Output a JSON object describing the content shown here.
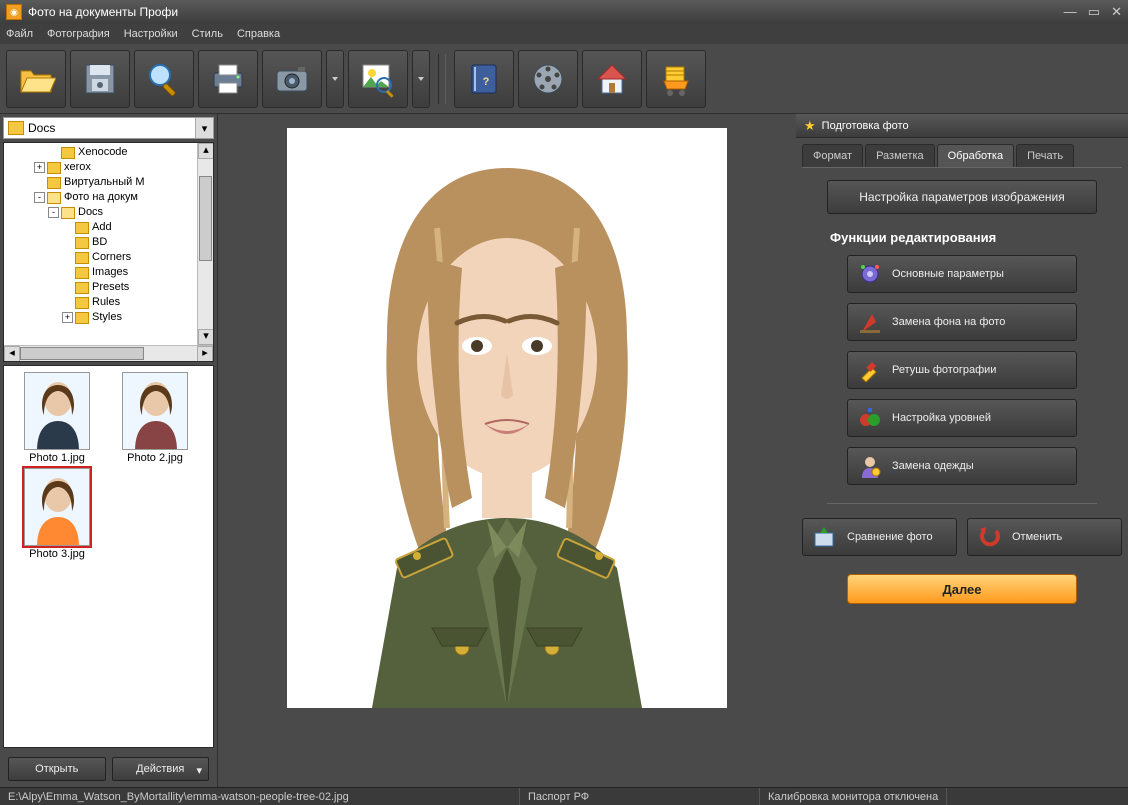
{
  "window": {
    "title": "Фото на документы Профи"
  },
  "menu": {
    "items": [
      "Файл",
      "Фотография",
      "Настройки",
      "Стиль",
      "Справка"
    ]
  },
  "toolbar_icons": [
    "open",
    "save",
    "zoom",
    "print",
    "camera",
    "image-search",
    "help-book",
    "film-reel",
    "home",
    "shopping-cart"
  ],
  "sidebar": {
    "path": "Docs",
    "tree": [
      {
        "indent": 3,
        "exp": "",
        "label": "Xenocode"
      },
      {
        "indent": 2,
        "exp": "+",
        "label": "xerox"
      },
      {
        "indent": 2,
        "exp": "",
        "label": "Виртуальный М"
      },
      {
        "indent": 2,
        "exp": "-",
        "label": "Фото на докум",
        "open": true
      },
      {
        "indent": 3,
        "exp": "-",
        "label": "Docs",
        "open": true
      },
      {
        "indent": 4,
        "exp": "",
        "label": "Add"
      },
      {
        "indent": 4,
        "exp": "",
        "label": "BD"
      },
      {
        "indent": 4,
        "exp": "",
        "label": "Corners"
      },
      {
        "indent": 4,
        "exp": "",
        "label": "Images"
      },
      {
        "indent": 4,
        "exp": "",
        "label": "Presets"
      },
      {
        "indent": 4,
        "exp": "",
        "label": "Rules"
      },
      {
        "indent": 4,
        "exp": "+",
        "label": "Styles"
      }
    ],
    "thumbs": [
      {
        "label": "Photo 1.jpg",
        "selected": false
      },
      {
        "label": "Photo 2.jpg",
        "selected": false
      },
      {
        "label": "Photo 3.jpg",
        "selected": true
      }
    ],
    "open_btn": "Открыть",
    "actions_btn": "Действия"
  },
  "right": {
    "header": "Подготовка фото",
    "tabs": [
      "Формат",
      "Разметка",
      "Обработка",
      "Печать"
    ],
    "active_tab": 2,
    "settings_btn": "Настройка параметров изображения",
    "section_title": "Функции редактирования",
    "funcs": [
      {
        "icon": "gear",
        "label": "Основные параметры"
      },
      {
        "icon": "bg",
        "label": "Замена фона на фото"
      },
      {
        "icon": "brush",
        "label": "Ретушь фотографии"
      },
      {
        "icon": "levels",
        "label": "Настройка уровней"
      },
      {
        "icon": "clothes",
        "label": "Замена одежды"
      }
    ],
    "compare_btn": "Сравнение фото",
    "cancel_btn": "Отменить",
    "next_btn": "Далее"
  },
  "status": {
    "path": "E:\\Alpy\\Emma_Watson_ByMortallity\\emma-watson-people-tree-02.jpg",
    "format": "Паспорт РФ",
    "calib": "Калибровка монитора отключена"
  }
}
